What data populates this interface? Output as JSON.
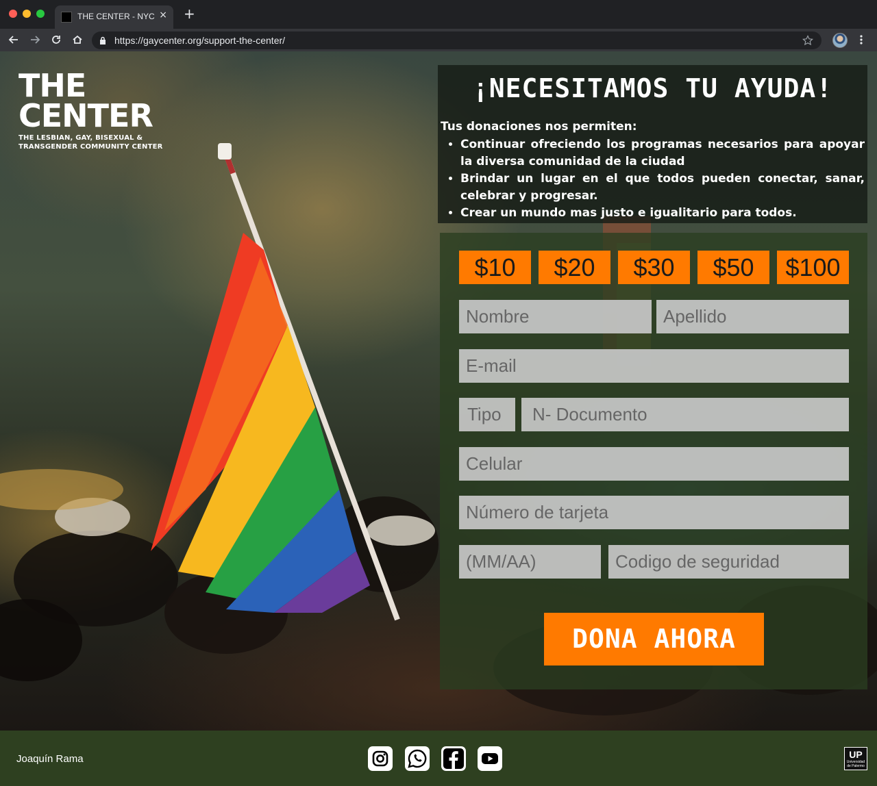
{
  "browser": {
    "tab_title": "THE CENTER - NYC",
    "url": "https://gaycenter.org/support-the-center/"
  },
  "logo": {
    "line1": "THE",
    "line2": "CENTER",
    "sub1": "THE LESBIAN, GAY, BISEXUAL &",
    "sub2": "TRANSGENDER COMMUNITY CENTER"
  },
  "info": {
    "title": "¡NECESITAMOS TU AYUDA!",
    "intro": "Tus donaciones nos permiten:",
    "items": [
      "Continuar ofreciendo los programas necesarios para apoyar la diversa comunidad de la ciudad",
      "Brindar un lugar en el que todos pueden conectar, sanar, celebrar y progresar.",
      "Crear un mundo mas justo e igualitario para todos."
    ]
  },
  "form": {
    "amounts": [
      "$10",
      "$20",
      "$30",
      "$50",
      "$100"
    ],
    "placeholders": {
      "nombre": "Nombre",
      "apellido": "Apellido",
      "email": "E-mail",
      "tipo": "Tipo",
      "documento": "N- Documento",
      "celular": "Celular",
      "tarjeta": "Número de tarjeta",
      "vencimiento": "(MM/AA)",
      "codigo": "Codigo de seguridad"
    },
    "submit_label": "DONA AHORA"
  },
  "footer": {
    "author": "Joaquín Rama",
    "social_icons": [
      "instagram-icon",
      "whatsapp-icon",
      "facebook-icon",
      "youtube-icon"
    ],
    "up_logo": {
      "big": "UP",
      "small1": "Universidad",
      "small2": "de Palermo"
    }
  },
  "colors": {
    "accent": "#ff7a00",
    "footer_bg": "#2e4020",
    "chrome_bg": "#202124"
  }
}
